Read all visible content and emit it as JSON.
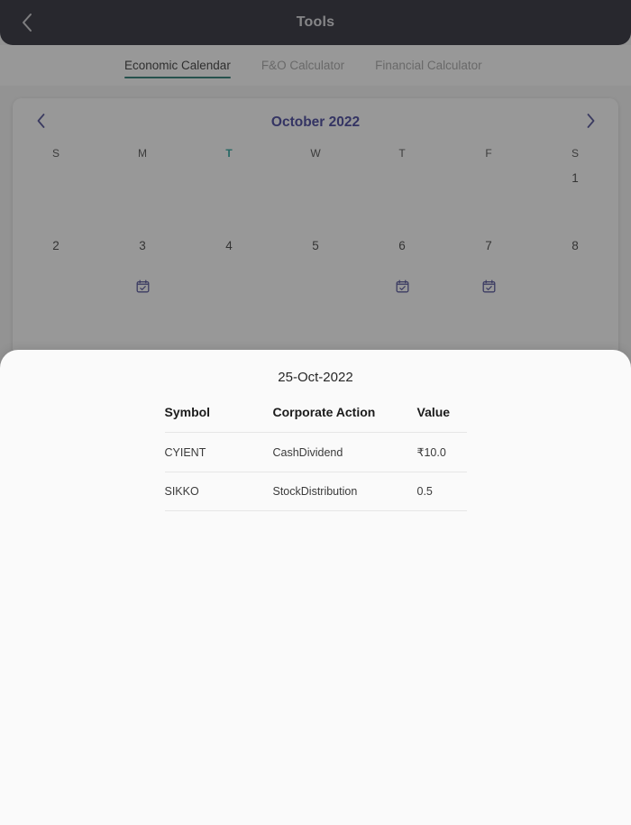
{
  "appbar": {
    "title": "Tools",
    "back_icon": "chevron-left-icon"
  },
  "tabs": [
    {
      "label": "Economic Calendar",
      "active": true
    },
    {
      "label": "F&O Calculator",
      "active": false
    },
    {
      "label": "Financial Calculator",
      "active": false
    }
  ],
  "calendar": {
    "month_title": "October 2022",
    "prev_icon": "chevron-left-icon",
    "next_icon": "chevron-right-icon",
    "weekdays": [
      {
        "label": "S",
        "highlight": false
      },
      {
        "label": "M",
        "highlight": false
      },
      {
        "label": "T",
        "highlight": true
      },
      {
        "label": "W",
        "highlight": false
      },
      {
        "label": "T",
        "highlight": false
      },
      {
        "label": "F",
        "highlight": false
      },
      {
        "label": "S",
        "highlight": false
      }
    ],
    "weeks": [
      [
        {
          "day": "",
          "event": false
        },
        {
          "day": "",
          "event": false
        },
        {
          "day": "",
          "event": false
        },
        {
          "day": "",
          "event": false
        },
        {
          "day": "",
          "event": false
        },
        {
          "day": "",
          "event": false
        },
        {
          "day": "1",
          "event": false
        }
      ],
      [
        {
          "day": "2",
          "event": false
        },
        {
          "day": "3",
          "event": true
        },
        {
          "day": "4",
          "event": false
        },
        {
          "day": "5",
          "event": false
        },
        {
          "day": "6",
          "event": true
        },
        {
          "day": "7",
          "event": true
        },
        {
          "day": "8",
          "event": false
        }
      ]
    ]
  },
  "sheet": {
    "date_title": "25-Oct-2022",
    "columns": [
      "Symbol",
      "Corporate Action",
      "Value"
    ],
    "rows": [
      {
        "symbol": "CYIENT",
        "action": "CashDividend",
        "value": "₹10.0"
      },
      {
        "symbol": "SIKKO",
        "action": "StockDistribution",
        "value": "0.5"
      }
    ]
  },
  "colors": {
    "appbar_bg": "#12121f",
    "accent_teal": "#0f6b63",
    "weekday_highlight": "#0f9a93",
    "month_title": "#2b2b8f",
    "event_icon": "#3b3b8c"
  }
}
